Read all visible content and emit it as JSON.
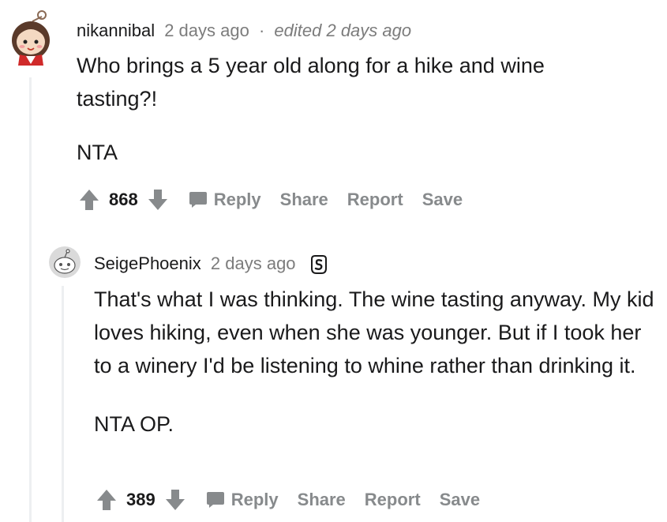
{
  "comments": [
    {
      "author": "nikannibal",
      "time": "2 days ago",
      "separator": "·",
      "edited": "edited 2 days ago",
      "paragraphs": [
        "Who brings a 5 year old along for a hike and wine tasting?!",
        "NTA"
      ],
      "score": "868",
      "actions": {
        "reply": "Reply",
        "share": "Share",
        "report": "Report",
        "save": "Save"
      }
    },
    {
      "author": "SeigePhoenix",
      "time": "2 days ago",
      "flair_icon": "snoo-award-icon",
      "paragraphs": [
        "That's what I was thinking. The wine tasting anyway. My kid loves hiking, even when she was younger. But if I took her to a winery I'd be listening to whine rather than drinking it.",
        "NTA OP."
      ],
      "score": "389",
      "actions": {
        "reply": "Reply",
        "share": "Share",
        "report": "Report",
        "save": "Save"
      }
    }
  ],
  "colors": {
    "text": "#1a1a1b",
    "meta": "#7c7c7c",
    "action": "#878a8c",
    "thread_line": "#edeff1"
  }
}
